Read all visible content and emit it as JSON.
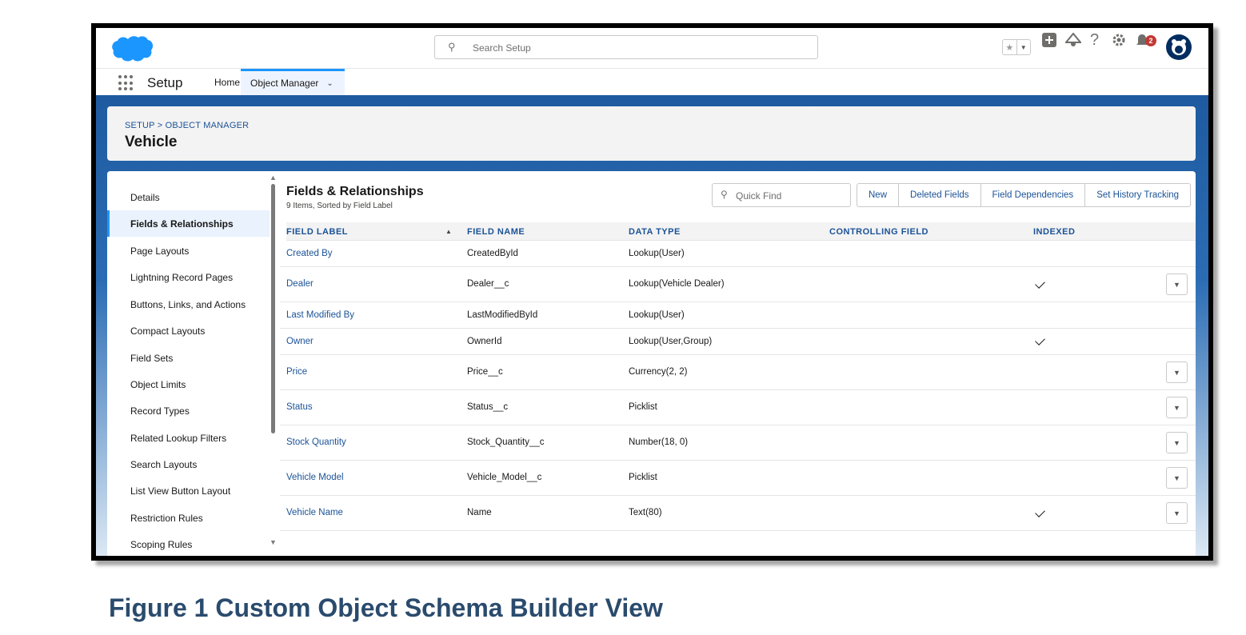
{
  "header": {
    "search_placeholder": "Search Setup",
    "notification_count": "2",
    "icons": [
      "search-icon",
      "star-icon",
      "chevron-down-icon",
      "plus-icon",
      "trailhead-icon",
      "help-icon",
      "gear-icon",
      "bell-icon",
      "avatar"
    ]
  },
  "context_bar": {
    "app_name": "Setup",
    "tabs": [
      {
        "label": "Home"
      },
      {
        "label": "Object Manager"
      }
    ]
  },
  "page_header": {
    "breadcrumb": "SETUP > OBJECT MANAGER",
    "title": "Vehicle"
  },
  "sidebar": {
    "items": [
      {
        "label": "Details"
      },
      {
        "label": "Fields & Relationships"
      },
      {
        "label": "Page Layouts"
      },
      {
        "label": "Lightning Record Pages"
      },
      {
        "label": "Buttons, Links, and Actions"
      },
      {
        "label": "Compact Layouts"
      },
      {
        "label": "Field Sets"
      },
      {
        "label": "Object Limits"
      },
      {
        "label": "Record Types"
      },
      {
        "label": "Related Lookup Filters"
      },
      {
        "label": "Search Layouts"
      },
      {
        "label": "List View Button Layout"
      },
      {
        "label": "Restriction Rules"
      },
      {
        "label": "Scoping Rules"
      }
    ],
    "active_index": 1
  },
  "main": {
    "title": "Fields & Relationships",
    "subtitle": "9 Items, Sorted by Field Label",
    "quick_find_placeholder": "Quick Find",
    "buttons": {
      "new": "New",
      "deleted_fields": "Deleted Fields",
      "field_dependencies": "Field Dependencies",
      "set_history_tracking": "Set History Tracking"
    },
    "columns": {
      "field_label": "FIELD LABEL",
      "field_name": "FIELD NAME",
      "data_type": "DATA TYPE",
      "controlling_field": "CONTROLLING FIELD",
      "indexed": "INDEXED"
    },
    "rows": [
      {
        "label": "Created By",
        "name": "CreatedById",
        "type": "Lookup(User)",
        "controlling": "",
        "indexed": false,
        "has_menu": false
      },
      {
        "label": "Dealer",
        "name": "Dealer__c",
        "type": "Lookup(Vehicle Dealer)",
        "controlling": "",
        "indexed": true,
        "has_menu": true
      },
      {
        "label": "Last Modified By",
        "name": "LastModifiedById",
        "type": "Lookup(User)",
        "controlling": "",
        "indexed": false,
        "has_menu": false
      },
      {
        "label": "Owner",
        "name": "OwnerId",
        "type": "Lookup(User,Group)",
        "controlling": "",
        "indexed": true,
        "has_menu": false
      },
      {
        "label": "Price",
        "name": "Price__c",
        "type": "Currency(2, 2)",
        "controlling": "",
        "indexed": false,
        "has_menu": true
      },
      {
        "label": "Status",
        "name": "Status__c",
        "type": "Picklist",
        "controlling": "",
        "indexed": false,
        "has_menu": true
      },
      {
        "label": "Stock Quantity",
        "name": "Stock_Quantity__c",
        "type": "Number(18, 0)",
        "controlling": "",
        "indexed": false,
        "has_menu": true
      },
      {
        "label": "Vehicle Model",
        "name": "Vehicle_Model__c",
        "type": "Picklist",
        "controlling": "",
        "indexed": false,
        "has_menu": true
      },
      {
        "label": "Vehicle Name",
        "name": "Name",
        "type": "Text(80)",
        "controlling": "",
        "indexed": true,
        "has_menu": true
      }
    ]
  },
  "caption": "Figure 1  Custom Object Schema Builder View",
  "colors": {
    "brand": "#1b96ff",
    "link": "#1b5297",
    "header_band": "#1e5aa0",
    "notification": "#c23934",
    "caption": "#2a4b6d"
  }
}
